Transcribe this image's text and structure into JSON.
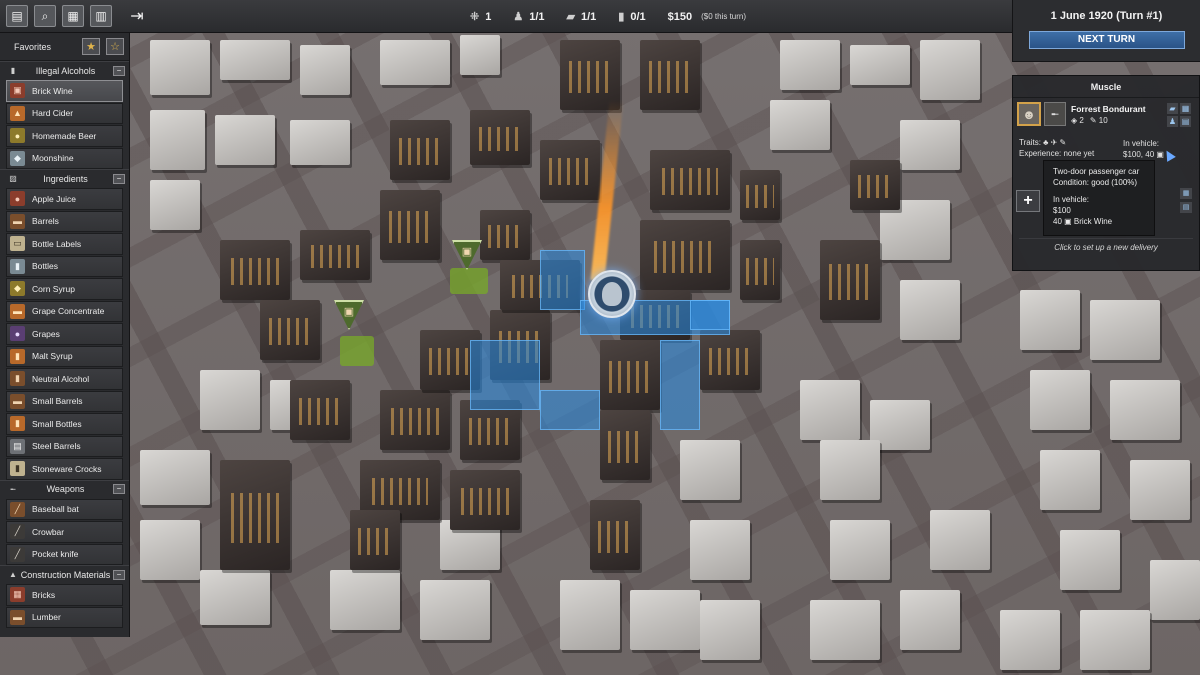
{
  "toolbar": {
    "buttons": [
      {
        "name": "ledger-icon",
        "glyph": "▤"
      },
      {
        "name": "map-search-icon",
        "glyph": "⌕"
      },
      {
        "name": "document-icon",
        "glyph": "▦"
      },
      {
        "name": "calendar-icon",
        "glyph": "▥"
      }
    ],
    "exit_glyph": "⇥"
  },
  "stats": {
    "crew": "1",
    "muscle": "1/1",
    "vehicles": "1/1",
    "trucks": "0/1",
    "money": "$150",
    "money_note": "($0 this turn)"
  },
  "turn": {
    "date": "1 June 1920 (Turn #1)",
    "next_turn_label": "NEXT TURN"
  },
  "sidebar": {
    "favorites_label": "Favorites",
    "categories": [
      {
        "label": "Illegal Alcohols",
        "icon": "bottle-icon",
        "glyph": "▮",
        "items": [
          {
            "label": "Brick Wine",
            "glyph": "▣",
            "tone": "t-brick",
            "selected": true
          },
          {
            "label": "Hard Cider",
            "glyph": "▲",
            "tone": "t-amber"
          },
          {
            "label": "Homemade Beer",
            "glyph": "●",
            "tone": "t-gold"
          },
          {
            "label": "Moonshine",
            "glyph": "◆",
            "tone": "t-glass"
          }
        ]
      },
      {
        "label": "Ingredients",
        "icon": "ingredients-icon",
        "glyph": "▨",
        "items": [
          {
            "label": "Apple Juice",
            "glyph": "●",
            "tone": "t-brick"
          },
          {
            "label": "Barrels",
            "glyph": "▬",
            "tone": "t-wood"
          },
          {
            "label": "Bottle Labels",
            "glyph": "▭",
            "tone": "t-cream"
          },
          {
            "label": "Bottles",
            "glyph": "▮",
            "tone": "t-glass"
          },
          {
            "label": "Corn Syrup",
            "glyph": "◆",
            "tone": "t-gold"
          },
          {
            "label": "Grape Concentrate",
            "glyph": "▬",
            "tone": "t-amber"
          },
          {
            "label": "Grapes",
            "glyph": "●",
            "tone": "t-purple"
          },
          {
            "label": "Malt Syrup",
            "glyph": "▮",
            "tone": "t-amber"
          },
          {
            "label": "Neutral Alcohol",
            "glyph": "▮",
            "tone": "t-wood"
          },
          {
            "label": "Small Barrels",
            "glyph": "▬",
            "tone": "t-wood"
          },
          {
            "label": "Small Bottles",
            "glyph": "▮",
            "tone": "t-amber"
          },
          {
            "label": "Steel Barrels",
            "glyph": "▤",
            "tone": "t-steel"
          },
          {
            "label": "Stoneware Crocks",
            "glyph": "▮",
            "tone": "t-cream"
          }
        ]
      },
      {
        "label": "Weapons",
        "icon": "pistol-icon",
        "glyph": "╾",
        "items": [
          {
            "label": "Baseball bat",
            "glyph": "╱",
            "tone": "t-wood"
          },
          {
            "label": "Crowbar",
            "glyph": "╱",
            "tone": "t-dark"
          },
          {
            "label": "Pocket knife",
            "glyph": "╱",
            "tone": "t-dark"
          }
        ]
      },
      {
        "label": "Construction Materials",
        "icon": "construction-icon",
        "glyph": "▲",
        "items": [
          {
            "label": "Bricks",
            "glyph": "▦",
            "tone": "t-brick"
          },
          {
            "label": "Lumber",
            "glyph": "▬",
            "tone": "t-wood"
          }
        ]
      }
    ]
  },
  "muscle": {
    "title": "Muscle",
    "name": "Forrest Bondurant",
    "stat_a": "2",
    "stat_b": "10",
    "traits_label": "Traits:",
    "experience": "Experience: none yet",
    "vehicle_label": "In vehicle:",
    "vehicle_value": "$100, 40",
    "footer": "Click to set up a new delivery",
    "add_glyph": "+"
  },
  "tooltip": {
    "vehicle": "Two-door passenger car",
    "condition": "Condition: good (100%)",
    "in_vehicle": "In vehicle:",
    "cash": "$100",
    "cargo": "40 ▣ Brick Wine"
  },
  "colors": {
    "accent_blue": "#2a5387",
    "highlight_blue": "#288ce6",
    "portrait_border": "#d3a24a"
  }
}
